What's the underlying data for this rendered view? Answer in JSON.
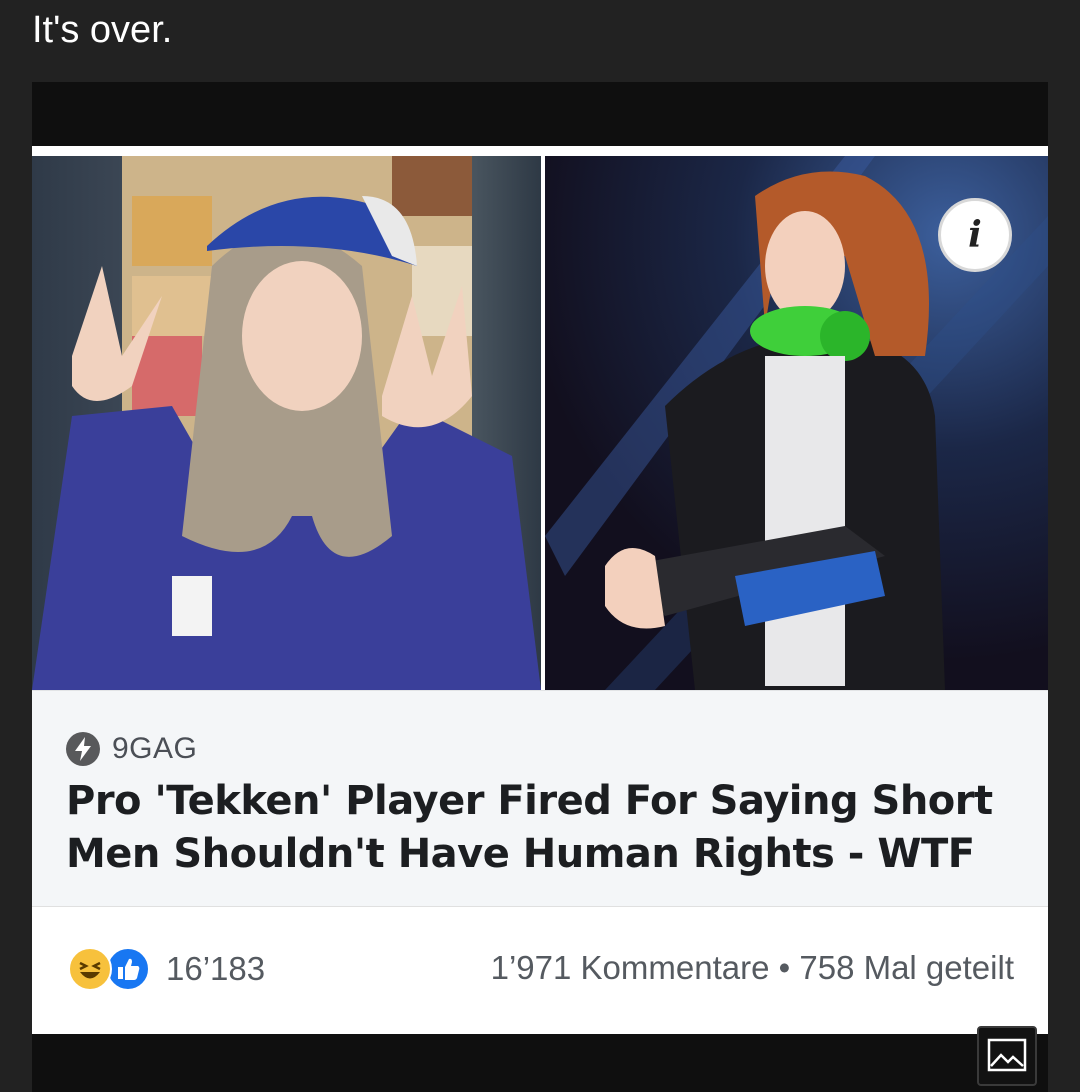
{
  "post": {
    "caption": "It's over."
  },
  "link_preview": {
    "source": "9GAG",
    "headline": "Pro 'Tekken' Player Fired For Saying Short Men Shouldn't Have Human Rights - WTF",
    "left_image": "photo of player with Red Bull cap making peace signs",
    "right_image": "photo of player with green headphones holding arcade stick",
    "info_icon": "info-icon"
  },
  "engagement": {
    "reaction_icons": [
      "haha-emoji-icon",
      "like-thumb-icon"
    ],
    "reaction_count": "16’183",
    "comments": "1’971 Kommentare",
    "separator": "•",
    "shares": "758 Mal geteilt"
  },
  "toolbar": {
    "gallery_icon": "gallery-icon"
  }
}
